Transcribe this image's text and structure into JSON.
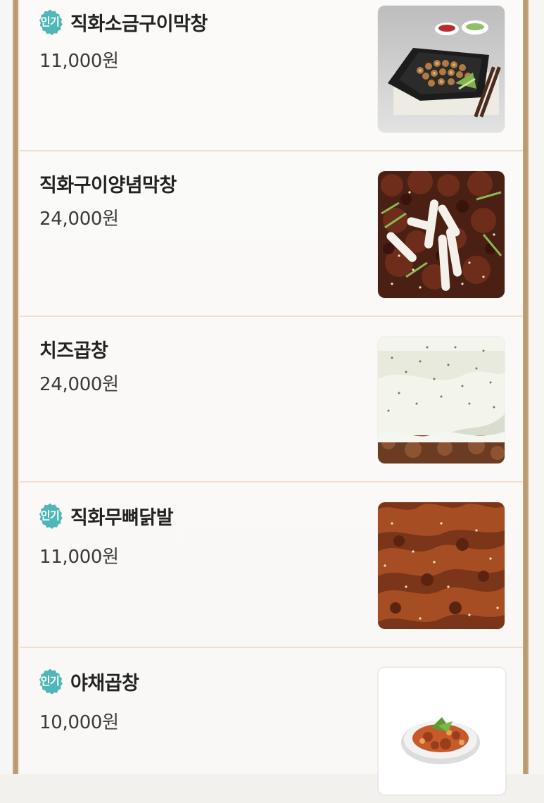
{
  "badge_label": "인기",
  "items": [
    {
      "name": "직화소금구이막창",
      "price": "11,000원",
      "popular": true,
      "photo": "grilled-salted-makchang-photo"
    },
    {
      "name": "직화구이양념막창",
      "price": "24,000원",
      "popular": false,
      "photo": "spicy-makchang-photo"
    },
    {
      "name": "치즈곱창",
      "price": "24,000원",
      "popular": false,
      "photo": "cheese-gopchang-photo"
    },
    {
      "name": "직화무뼈닭발",
      "price": "11,000원",
      "popular": true,
      "photo": "boneless-chicken-feet-photo"
    },
    {
      "name": "야채곱창",
      "price": "10,000원",
      "popular": true,
      "photo": "vegetable-gopchang-photo"
    }
  ],
  "colors": {
    "badge": "#4fb7b8",
    "frame_gold": "#b9956a",
    "divider": "#eedfd1"
  }
}
